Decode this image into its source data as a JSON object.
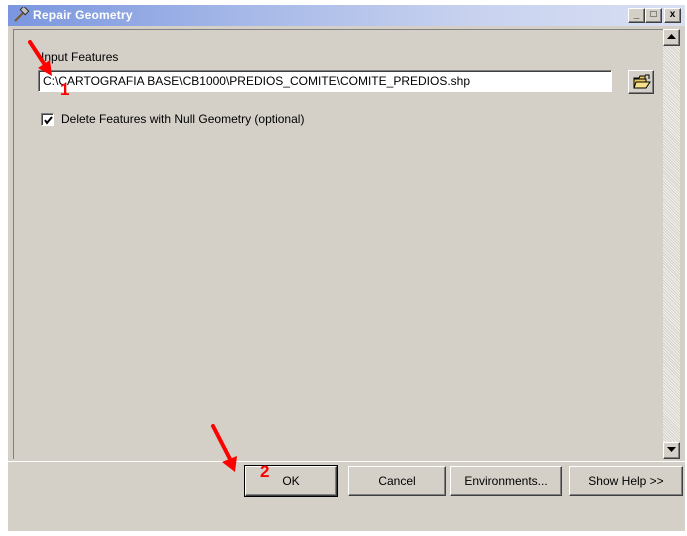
{
  "window": {
    "title": "Repair Geometry",
    "controls": {
      "minimize": "_",
      "maximize": "□",
      "close": "x"
    }
  },
  "form": {
    "input_label": "Input Features",
    "input_value": "C:\\CARTOGRAFIA BASE\\CB1000\\PREDIOS_COMITE\\COMITE_PREDIOS.shp",
    "checkbox_label": "Delete Features with Null Geometry (optional)",
    "checkbox_checked": true
  },
  "buttons": {
    "ok": "OK",
    "cancel": "Cancel",
    "environments": "Environments...",
    "help": "Show Help >>"
  },
  "annotations": {
    "marker_1": "1",
    "marker_2": "2",
    "arrow_color": "#ff0000"
  },
  "icons": {
    "title": "hammer-icon",
    "browse": "open-folder-icon",
    "check": "checkmark-icon"
  },
  "colors": {
    "window_bg": "#d4d0c8",
    "title_gradient_start": "#7a96df",
    "title_text": "#ffffff"
  }
}
